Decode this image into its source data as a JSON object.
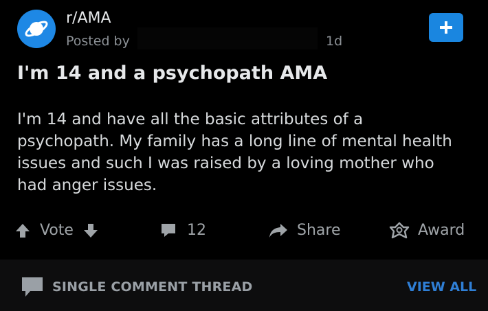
{
  "post": {
    "subreddit": "r/AMA",
    "posted_by": "Posted by",
    "age": "1d",
    "title": "I'm 14 and a psychopath AMA",
    "body": "I'm 14 and have all the basic attributes of a psychopath. My family has a long line of mental health issues and such I was raised by a loving mother who had anger issues."
  },
  "actions": {
    "vote_label": "Vote",
    "comments_count": "12",
    "share_label": "Share",
    "award_label": "Award"
  },
  "thread_bar": {
    "label": "SINGLE COMMENT THREAD",
    "view_all": "VIEW ALL"
  },
  "icons": {
    "subreddit_avatar": "planet-icon",
    "join": "plus-icon",
    "upvote": "arrow-up-icon",
    "downvote": "arrow-down-icon",
    "comments": "comment-bubble-icon",
    "share": "share-arrow-icon",
    "award": "award-icon",
    "thread": "chat-bubble-icon"
  },
  "colors": {
    "background": "#000000",
    "accent": "#1a86e0",
    "muted_text": "#8c9196",
    "link": "#2f7fd6"
  }
}
